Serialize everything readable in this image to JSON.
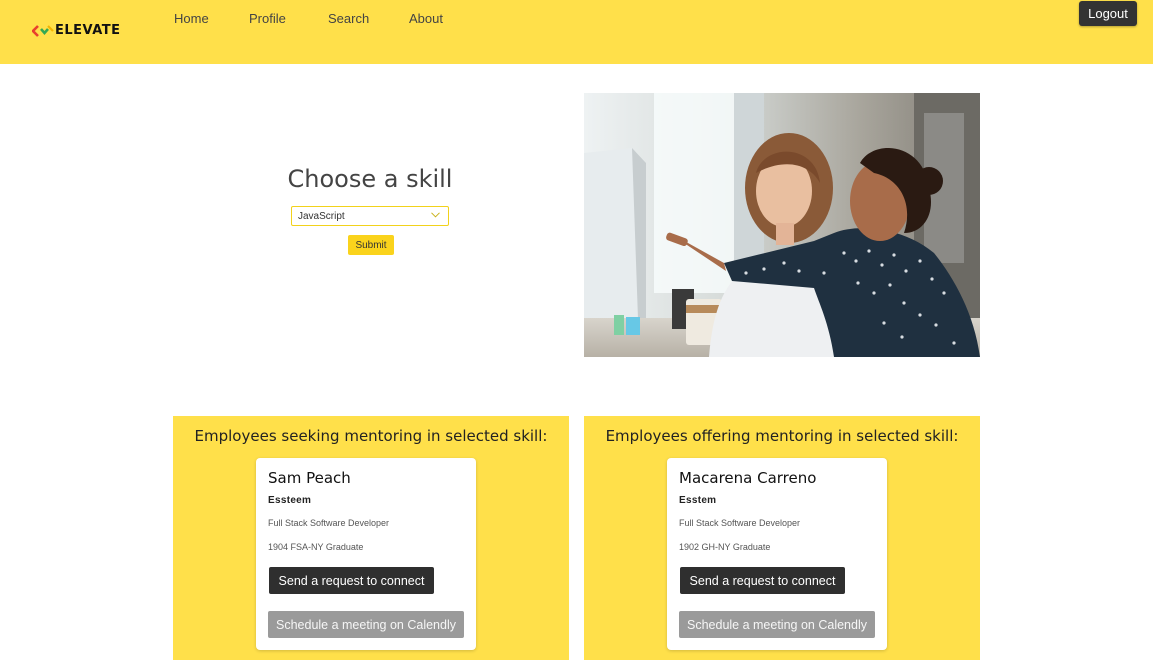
{
  "brand": {
    "name": "ELEVATE"
  },
  "nav": {
    "items": [
      {
        "label": "Home"
      },
      {
        "label": "Profile"
      },
      {
        "label": "Search"
      },
      {
        "label": "About"
      }
    ]
  },
  "header": {
    "logout_label": "Logout"
  },
  "skill_form": {
    "title": "Choose a skill",
    "selected_skill": "JavaScript",
    "submit_label": "Submit"
  },
  "seeking": {
    "title": "Employees seeking mentoring in selected skill:",
    "card": {
      "name": "Sam Peach",
      "company": "Essteem",
      "role": "Full Stack Software Developer",
      "graduate": "1904 FSA-NY Graduate",
      "connect_label": "Send a request to connect",
      "calendly_label": "Schedule a meeting on Calendly"
    }
  },
  "offering": {
    "title": "Employees offering mentoring in selected skill:",
    "card": {
      "name": "Macarena Carreno",
      "company": "Esstem",
      "role": "Full Stack Software Developer",
      "graduate": "1902 GH-NY Graduate",
      "connect_label": "Send a request to connect",
      "calendly_label": "Schedule a meeting on Calendly"
    }
  },
  "colors": {
    "accent_yellow": "#ffe04a",
    "button_yellow": "#fad31c",
    "dark_button": "#2f2f2f",
    "muted_button": "#9a9a9a"
  }
}
